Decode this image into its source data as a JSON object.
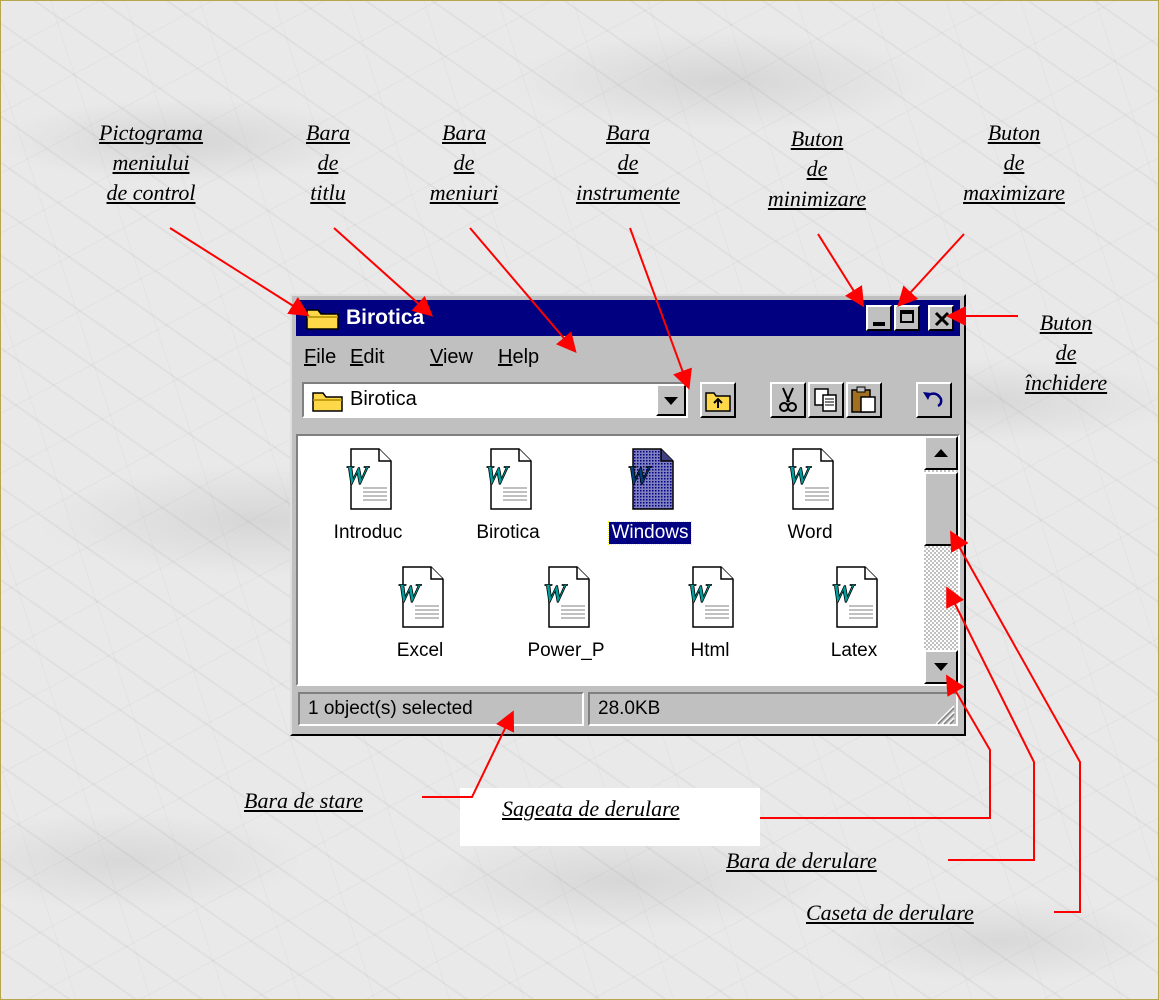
{
  "window": {
    "title": "Birotica",
    "menus": [
      "File",
      "Edit",
      "View",
      "Help"
    ],
    "menu_hotkeys": [
      "F",
      "E",
      "V",
      "H"
    ],
    "address_value": "Birotica",
    "files": [
      {
        "name": "Introduc",
        "selected": false
      },
      {
        "name": "Birotica",
        "selected": false
      },
      {
        "name": "Windows",
        "selected": true
      },
      {
        "name": "Word",
        "selected": false
      },
      {
        "name": "Excel",
        "selected": false
      },
      {
        "name": "Power_P",
        "selected": false
      },
      {
        "name": "Html",
        "selected": false
      },
      {
        "name": "Latex",
        "selected": false
      }
    ],
    "status_left": "1 object(s) selected",
    "status_right": "28.0KB",
    "title_bar_color": "#000080"
  },
  "annotations": {
    "control_menu_icon": [
      "Pictograma",
      "meniului",
      "de control"
    ],
    "title_bar": [
      "Bara",
      "de",
      "titlu"
    ],
    "menu_bar": [
      "Bara",
      "de",
      "meniuri"
    ],
    "tool_bar": [
      "Bara",
      "de",
      "instrumente"
    ],
    "minimize_button": [
      "Buton",
      "de",
      "minimizare"
    ],
    "maximize_button": [
      "Buton",
      "de",
      "maximizare"
    ],
    "close_button": [
      "Buton",
      "de",
      "închidere"
    ],
    "status_bar": "Bara de stare",
    "scroll_arrow": "Sageata de derulare",
    "scroll_bar": "Bara de derulare",
    "scroll_box": "Caseta de derulare",
    "arrow_color": "#ff0000"
  }
}
